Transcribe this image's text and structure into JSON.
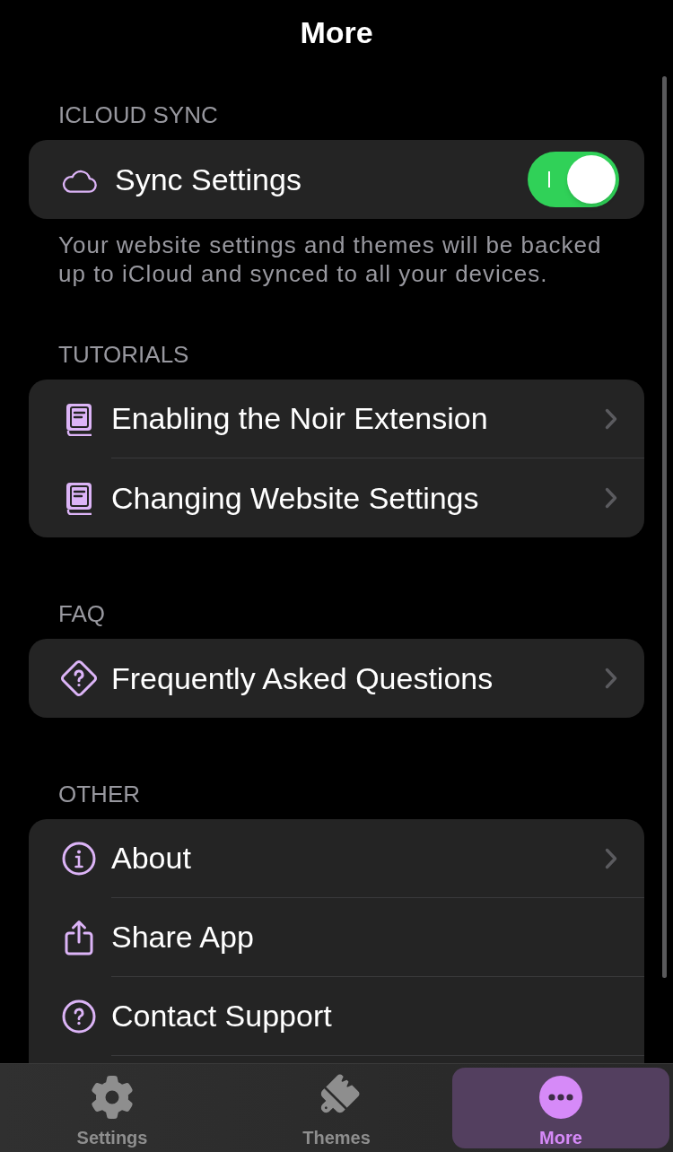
{
  "title": "More",
  "sections": [
    {
      "header": "ICLOUD SYNC",
      "rows": [
        {
          "kind": "toggle",
          "label": "Sync Settings",
          "on": true
        }
      ],
      "footer": "Your website settings and themes will be backed up to iCloud and synced to all your devices."
    },
    {
      "header": "TUTORIALS",
      "rows": [
        {
          "kind": "disclosure",
          "label": "Enabling the Noir Extension"
        },
        {
          "kind": "disclosure",
          "label": "Changing Website Settings"
        }
      ]
    },
    {
      "header": "FAQ",
      "rows": [
        {
          "kind": "disclosure",
          "label": "Frequently Asked Questions"
        }
      ]
    },
    {
      "header": "OTHER",
      "rows": [
        {
          "kind": "disclosure",
          "label": "About"
        },
        {
          "kind": "action",
          "label": "Share App"
        },
        {
          "kind": "action",
          "label": "Contact Support"
        }
      ]
    }
  ],
  "tab_bar": {
    "tabs": [
      {
        "label": "Settings",
        "selected": false
      },
      {
        "label": "Themes",
        "selected": false
      },
      {
        "label": "More",
        "selected": true
      }
    ]
  }
}
